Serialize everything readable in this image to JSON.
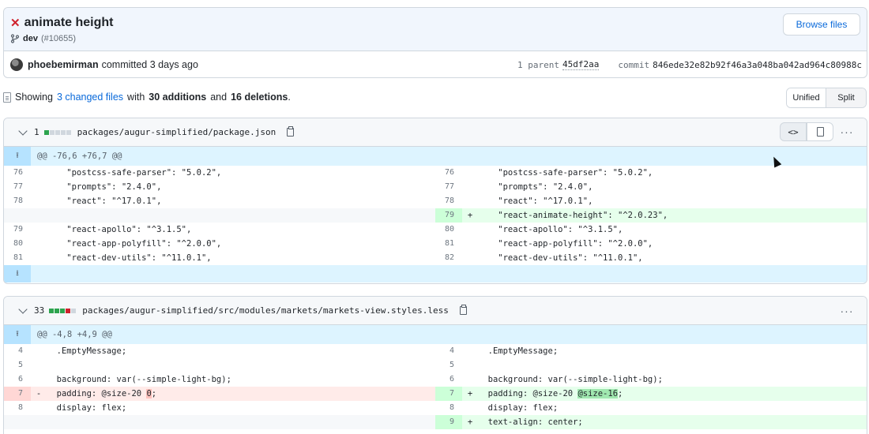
{
  "commit": {
    "title": "animate height",
    "branch": "dev",
    "pr": "(#10655)",
    "browse_label": "Browse files",
    "author": "phoebemirman",
    "committed_text": "committed 3 days ago",
    "parent_label": "1 parent",
    "parent_hash": "45df2aa",
    "commit_label": "commit",
    "commit_hash": "846ede32e82b92f46a3a048ba042ad964c80988c"
  },
  "summary": {
    "prefix": "Showing",
    "changed": "3 changed files",
    "with": "with",
    "additions": "30 additions",
    "and": "and",
    "deletions": "16 deletions",
    "suffix": "."
  },
  "view_toggle": {
    "unified": "Unified",
    "split": "Split"
  },
  "files": [
    {
      "count": "1",
      "path": "packages/augur-simplified/package.json",
      "hunk": "@@ -76,6 +76,7 @@",
      "rows": [
        {
          "l_ln": "76",
          "l_code": "    \"postcss-safe-parser\": \"5.0.2\",",
          "r_ln": "76",
          "r_code": "    \"postcss-safe-parser\": \"5.0.2\","
        },
        {
          "l_ln": "77",
          "l_code": "    \"prompts\": \"2.4.0\",",
          "r_ln": "77",
          "r_code": "    \"prompts\": \"2.4.0\","
        },
        {
          "l_ln": "78",
          "l_code": "    \"react\": \"^17.0.1\",",
          "r_ln": "78",
          "r_code": "    \"react\": \"^17.0.1\","
        },
        {
          "l_ln": "",
          "l_code": "",
          "r_ln": "79",
          "r_mark": "+",
          "r_code": "    \"react-animate-height\": \"^2.0.23\","
        },
        {
          "l_ln": "79",
          "l_code": "    \"react-apollo\": \"^3.1.5\",",
          "r_ln": "80",
          "r_code": "    \"react-apollo\": \"^3.1.5\","
        },
        {
          "l_ln": "80",
          "l_code": "    \"react-app-polyfill\": \"^2.0.0\",",
          "r_ln": "81",
          "r_code": "    \"react-app-polyfill\": \"^2.0.0\","
        },
        {
          "l_ln": "81",
          "l_code": "    \"react-dev-utils\": \"^11.0.1\",",
          "r_ln": "82",
          "r_code": "    \"react-dev-utils\": \"^11.0.1\","
        }
      ]
    },
    {
      "count": "33",
      "path": "packages/augur-simplified/src/modules/markets/markets-view.styles.less",
      "hunk": "@@ -4,8 +4,9 @@",
      "rows": [
        {
          "l_ln": "4",
          "l_code": "  .EmptyMessage;",
          "r_ln": "4",
          "r_code": "  .EmptyMessage;"
        },
        {
          "l_ln": "5",
          "l_code": "",
          "r_ln": "5",
          "r_code": ""
        },
        {
          "l_ln": "6",
          "l_code": "  background: var(--simple-light-bg);",
          "r_ln": "6",
          "r_code": "  background: var(--simple-light-bg);"
        },
        {
          "l_ln": "7",
          "l_mark": "-",
          "l_code_a": "  padding: @size-20 ",
          "l_code_hl": "0",
          "l_code_b": ";",
          "r_ln": "7",
          "r_mark": "+",
          "r_code_a": "  padding: @size-20 ",
          "r_code_hl": "@size-16",
          "r_code_b": ";"
        },
        {
          "l_ln": "8",
          "l_code": "  display: flex;",
          "r_ln": "8",
          "r_code": "  display: flex;"
        },
        {
          "l_ln": "",
          "l_code": "",
          "r_ln": "9",
          "r_mark": "+",
          "r_code": "  text-align: center;"
        }
      ]
    }
  ]
}
